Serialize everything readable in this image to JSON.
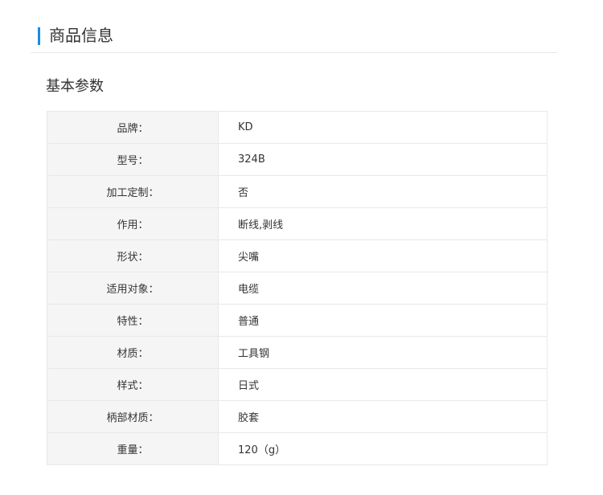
{
  "section": {
    "title": "商品信息"
  },
  "basic_params": {
    "title": "基本参数",
    "rows": [
      {
        "key": "品牌：",
        "value": "KD"
      },
      {
        "key": "型号：",
        "value": "324B"
      },
      {
        "key": "加工定制：",
        "value": "否"
      },
      {
        "key": "作用：",
        "value": "断线,剥线"
      },
      {
        "key": "形状：",
        "value": "尖嘴"
      },
      {
        "key": "适用对象：",
        "value": "电缆"
      },
      {
        "key": "特性：",
        "value": "普通"
      },
      {
        "key": "材质：",
        "value": "工具钢"
      },
      {
        "key": "样式：",
        "value": "日式"
      },
      {
        "key": "柄部材质：",
        "value": "胶套"
      },
      {
        "key": "重量：",
        "value": "120（g）"
      }
    ]
  },
  "colors": {
    "accent": "#1a8be0",
    "key_cell_bg": "#f5f5f5",
    "border": "#e8e8e8"
  }
}
